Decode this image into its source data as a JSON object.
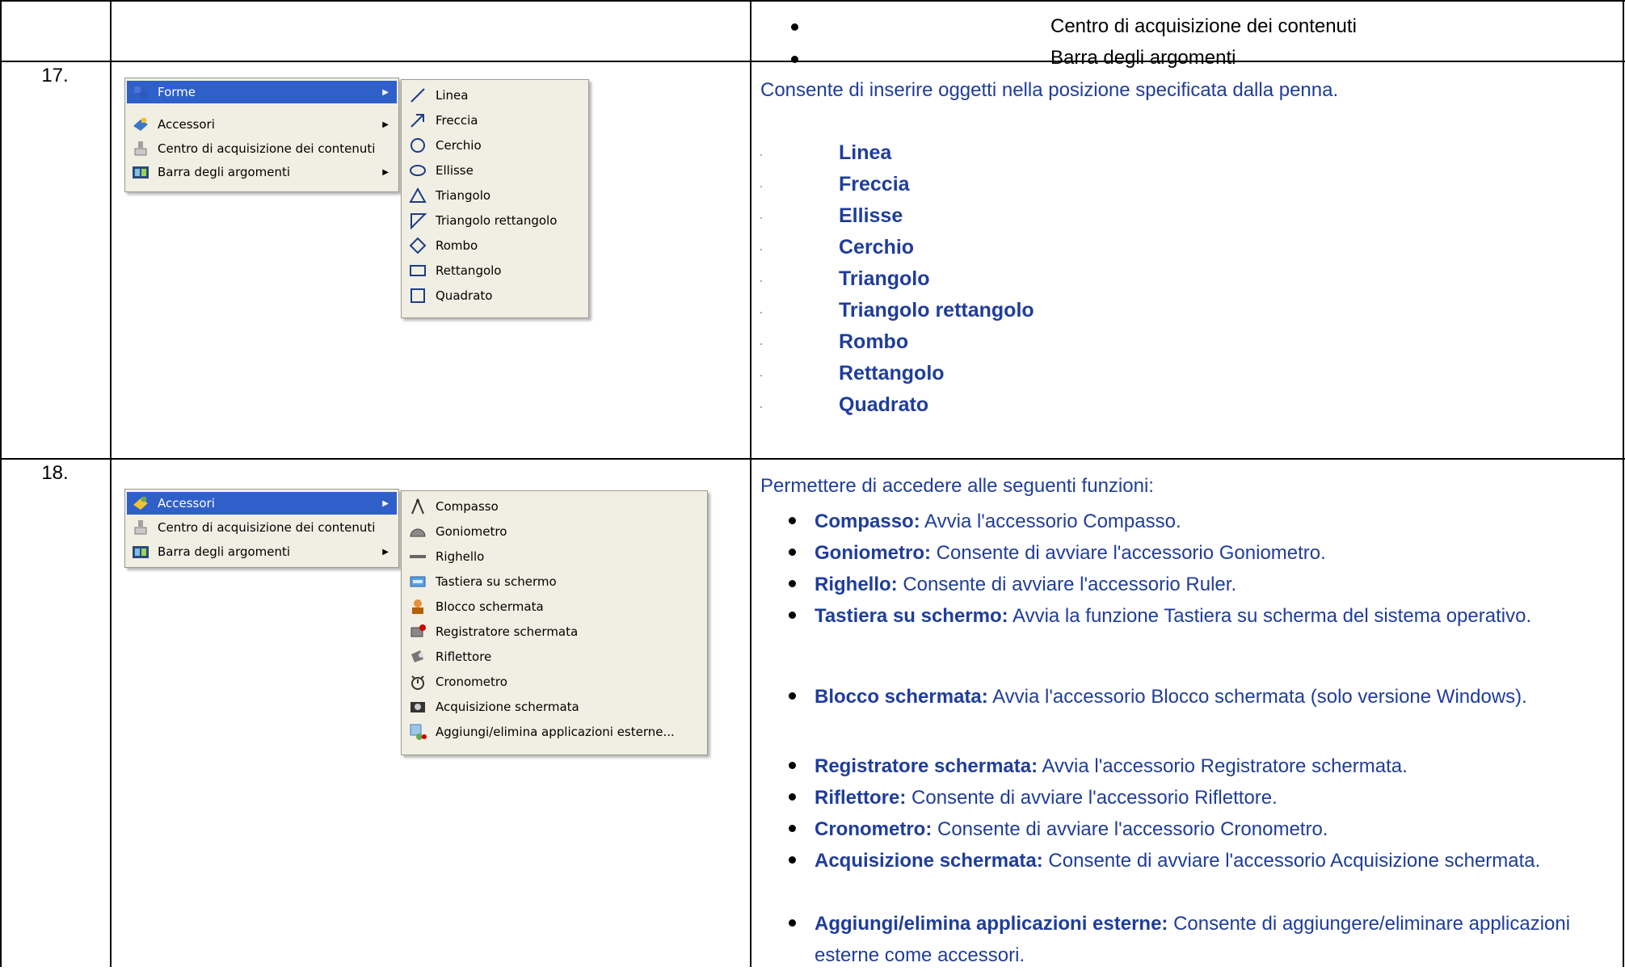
{
  "top_row": {
    "items": [
      "Centro di acquisizione dei contenuti",
      "Barra degli argomenti"
    ]
  },
  "row17": {
    "number": "17.",
    "menu": {
      "items": [
        {
          "label": "Forme",
          "icon": "shapes-icon",
          "submenu": true,
          "selected": true
        },
        {
          "label": "Accessori",
          "icon": "accessories-icon",
          "submenu": true,
          "selected": false
        },
        {
          "label": "Centro di acquisizione dei contenuti",
          "icon": "content-capture-icon",
          "submenu": false,
          "selected": false
        },
        {
          "label": "Barra degli argomenti",
          "icon": "topic-bar-icon",
          "submenu": true,
          "selected": false
        }
      ],
      "submenu": [
        {
          "label": "Linea",
          "icon": "line-icon"
        },
        {
          "label": "Freccia",
          "icon": "arrow-icon"
        },
        {
          "label": "Cerchio",
          "icon": "circle-icon"
        },
        {
          "label": "Ellisse",
          "icon": "ellipse-icon"
        },
        {
          "label": "Triangolo",
          "icon": "triangle-icon"
        },
        {
          "label": "Triangolo rettangolo",
          "icon": "right-triangle-icon"
        },
        {
          "label": "Rombo",
          "icon": "rhombus-icon"
        },
        {
          "label": "Rettangolo",
          "icon": "rectangle-icon"
        },
        {
          "label": "Quadrato",
          "icon": "square-icon"
        }
      ]
    },
    "description": "Consente di inserire oggetti nella posizione specificata dalla penna.",
    "shapes": [
      "Linea",
      "Freccia",
      "Ellisse",
      "Cerchio",
      "Triangolo",
      "Triangolo rettangolo",
      "Rombo",
      "Rettangolo",
      "Quadrato"
    ]
  },
  "row18": {
    "number": "18.",
    "menu": {
      "items": [
        {
          "label": "Accessori",
          "icon": "accessories-icon",
          "submenu": true,
          "selected": true
        },
        {
          "label": "Centro di acquisizione dei contenuti",
          "icon": "content-capture-icon",
          "submenu": false,
          "selected": false
        },
        {
          "label": "Barra degli argomenti",
          "icon": "topic-bar-icon",
          "submenu": true,
          "selected": false
        }
      ],
      "submenu": [
        {
          "label": "Compasso",
          "icon": "compass-icon"
        },
        {
          "label": "Goniometro",
          "icon": "protractor-icon"
        },
        {
          "label": "Righello",
          "icon": "ruler-icon"
        },
        {
          "label": "Tastiera su schermo",
          "icon": "keyboard-icon"
        },
        {
          "label": "Blocco schermata",
          "icon": "screen-block-icon"
        },
        {
          "label": "Registratore schermata",
          "icon": "screen-recorder-icon"
        },
        {
          "label": "Riflettore",
          "icon": "spotlight-icon"
        },
        {
          "label": "Cronometro",
          "icon": "stopwatch-icon"
        },
        {
          "label": "Acquisizione schermata",
          "icon": "screen-capture-icon"
        },
        {
          "label": "Aggiungi/elimina applicazioni esterne...",
          "icon": "add-remove-apps-icon"
        }
      ]
    },
    "intro": "Permettere di accedere alle seguenti funzioni:",
    "functions": [
      {
        "name": "Compasso:",
        "text": " Avvia l'accessorio Compasso."
      },
      {
        "name": "Goniometro:",
        "text": " Consente di avviare l'accessorio Goniometro."
      },
      {
        "name": "Righello:",
        "text": " Consente di avviare l'accessorio Ruler."
      },
      {
        "name": "Tastiera su schermo:",
        "text": " Avvia la funzione Tastiera su scherma del sistema operativo."
      },
      {
        "name": "Blocco schermata:",
        "text": " Avvia l'accessorio Blocco schermata (solo versione Windows)."
      },
      {
        "name": "Registratore schermata:",
        "text": " Avvia l'accessorio Registratore schermata."
      },
      {
        "name": "Riflettore:",
        "text": " Consente di avviare l'accessorio Riflettore."
      },
      {
        "name": "Cronometro:",
        "text": " Consente di avviare l'accessorio Cronometro."
      },
      {
        "name": "Acquisizione schermata:",
        "text": " Consente di avviare l'accessorio Acquisizione schermata."
      },
      {
        "name": "Aggiungi/elimina applicazioni esterne:",
        "text": " Consente di aggiungere/eliminare applicazioni esterne come accessori."
      }
    ]
  }
}
